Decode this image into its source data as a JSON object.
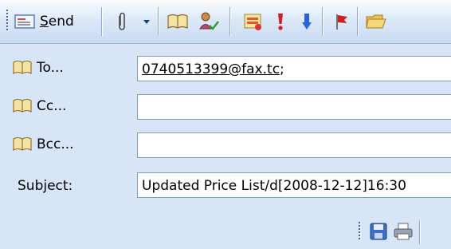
{
  "toolbar": {
    "send_label_first": "S",
    "send_label_rest": "end",
    "icons": [
      "send-envelope-icon",
      "attach-paperclip-icon",
      "dropdown-arrow-icon",
      "address-book-icon",
      "check-names-icon",
      "options-icon",
      "high-importance-icon",
      "low-importance-icon",
      "follow-up-flag-icon",
      "folder-icon"
    ]
  },
  "fields": {
    "to_label": "To...",
    "to_value": "0740513399@fax.tc",
    "to_suffix": ";",
    "cc_label": "Cc...",
    "cc_value": "",
    "bcc_label": "Bcc...",
    "bcc_value": "",
    "subject_label": "Subject:",
    "subject_value": "Updated Price List/d[2008-12-12]16:30"
  },
  "colors": {
    "background": "#d7e5f7",
    "field_border": "#7f9db9",
    "flag_red": "#d11f1f",
    "importance_blue": "#2a62d8"
  }
}
